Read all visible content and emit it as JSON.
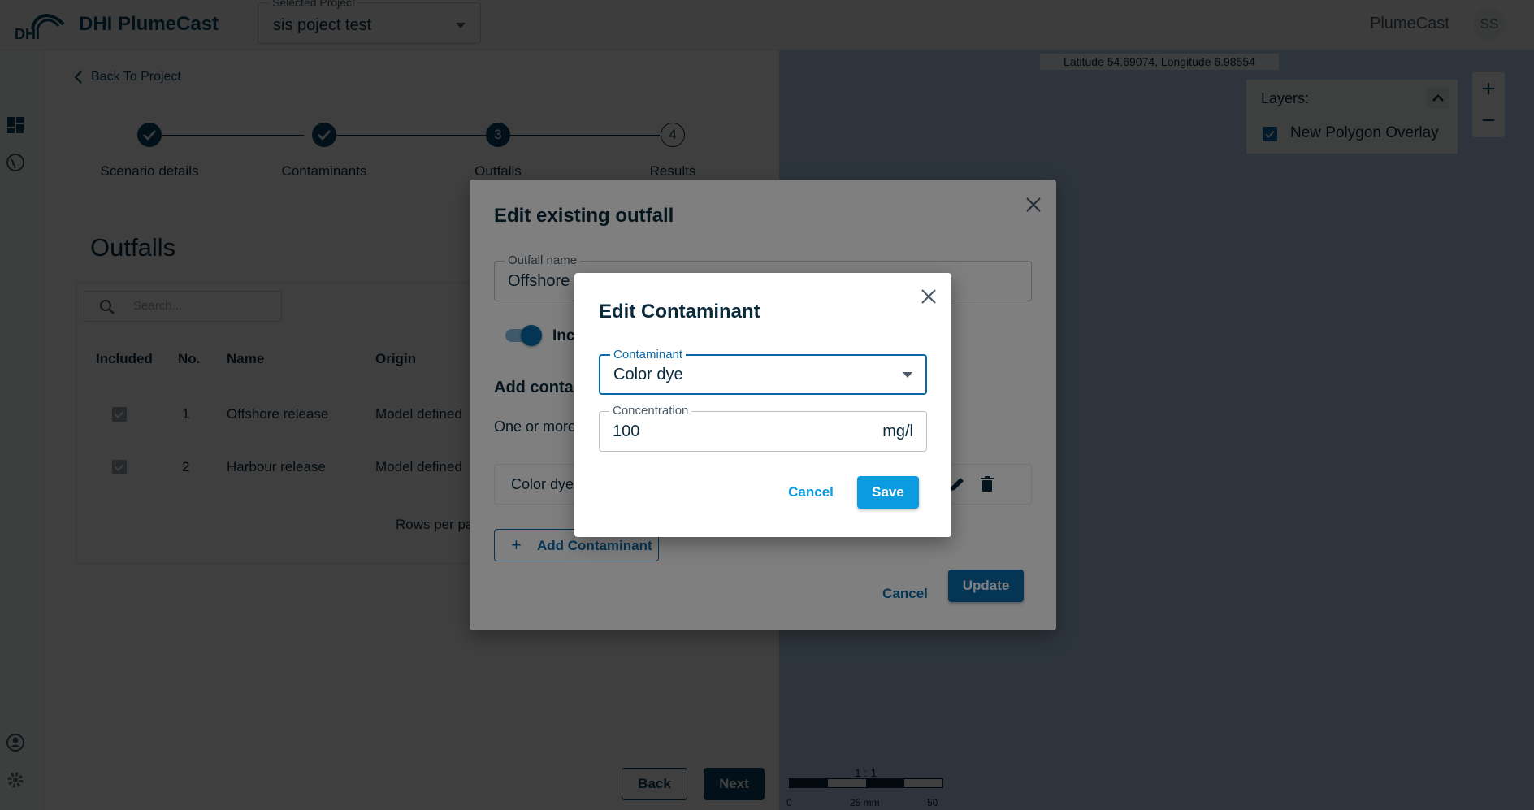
{
  "header": {
    "logo_text": "DHI",
    "app_name": "DHI PlumeCast",
    "project_select": {
      "label": "Selected Project",
      "value": "sis poject test"
    },
    "app_label": "PlumeCast",
    "avatar": "SS"
  },
  "left_panel": {
    "back_link": "Back To Project",
    "steps": [
      {
        "label": "Scenario details",
        "state": "done",
        "number": ""
      },
      {
        "label": "Contaminants",
        "state": "done",
        "number": ""
      },
      {
        "label": "Outfalls",
        "state": "active",
        "number": "3"
      },
      {
        "label": "Results",
        "state": "todo",
        "number": "4"
      }
    ],
    "title": "Outfalls",
    "search_placeholder": "Search...",
    "columns": [
      "Included",
      "No.",
      "Name",
      "Origin"
    ],
    "rows": [
      {
        "included": true,
        "no": "1",
        "name": "Offshore release",
        "origin": "Model defined"
      },
      {
        "included": true,
        "no": "2",
        "name": "Harbour release",
        "origin": "Model defined"
      }
    ],
    "rows_per_page": "Rows per pa",
    "back_button": "Back",
    "next_button": "Next"
  },
  "map": {
    "coords": "Latitude 54.69074, Longitude 6.98554",
    "layers_title": "Layers:",
    "layers": [
      {
        "name": "New Polygon Overlay",
        "checked": true
      }
    ],
    "zoom_in": "+",
    "zoom_out": "−",
    "scale_ratio": "1 : 1",
    "scale_ticks": [
      "0",
      "25 mm",
      "50 mm"
    ],
    "background_color": "#b4d2ee"
  },
  "outfall_dialog": {
    "title": "Edit existing outfall",
    "name_label": "Outfall name",
    "name_value": "Offshore",
    "toggle_label": "Inc",
    "toggle_on": true,
    "section_title": "Add contan",
    "hint": "One or more",
    "contaminant_row": "Color dye",
    "add_button": "Add Contaminant",
    "cancel_button": "Cancel",
    "update_button": "Update"
  },
  "contaminant_dialog": {
    "title": "Edit Contaminant",
    "contaminant_label": "Contaminant",
    "contaminant_value": "Color dye",
    "concentration_label": "Concentration",
    "concentration_value": "100",
    "concentration_unit": "mg/l",
    "cancel_button": "Cancel",
    "save_button": "Save"
  },
  "colors": {
    "primary_dark": "#0b4566",
    "primary": "#0b6aa8",
    "accent": "#0b9be0"
  }
}
